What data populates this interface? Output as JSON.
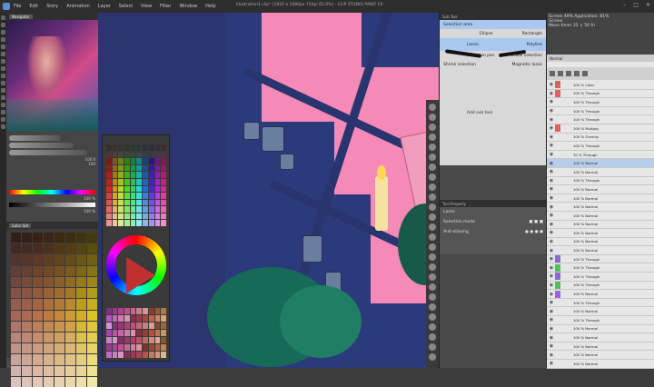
{
  "menubar": {
    "items": [
      "File",
      "Edit",
      "Story",
      "Animation",
      "Layer",
      "Select",
      "View",
      "Filter",
      "Window",
      "Help"
    ],
    "title": "Illustration1.clip* (1920 x 1080px 72dpi 65.0%) - CLIP STUDIO PAINT EX"
  },
  "canvas_tabs": [
    "Illustration1",
    "Sketch2",
    "Comm",
    "Painting (2)"
  ],
  "navigator": {
    "tab": "Navigator"
  },
  "brush": {
    "size_label": "100.0",
    "opacity_label": "100"
  },
  "color": {
    "values": [
      "100 %",
      "100 %",
      "100 %"
    ]
  },
  "colorset": {
    "tab": "Color Set"
  },
  "toolprop": {
    "tab": "Sub Tool",
    "items": [
      {
        "label": "Selection area",
        "active": true
      },
      {
        "label": "Ellipse",
        "right": "Rectangle"
      },
      {
        "label": "Lasso",
        "right": "Polyline",
        "active": true
      },
      {
        "label": "Selection pen",
        "right": "Erase selection"
      },
      {
        "label": "Shrink selection",
        "right": "Magnetic lasso"
      }
    ],
    "add_subtool": "Add sub tool",
    "lower_tab": "Tool Property",
    "lower_title": "Lasso",
    "option1": "Selection mode",
    "option2": "Anti-aliasing"
  },
  "layers": {
    "header_lines": [
      "Screen 49% Application: 81%",
      "Screen",
      "Move timer   22 × 50 fn"
    ],
    "blend_mode": "Normal",
    "rows": [
      {
        "name": "100 % Color",
        "mark": "#e06060"
      },
      {
        "name": "100 % Through",
        "mark": "#e06060"
      },
      {
        "name": "100 % Through",
        "mark": ""
      },
      {
        "name": "100 % Through",
        "mark": ""
      },
      {
        "name": "100 % Through",
        "mark": ""
      },
      {
        "name": "100 % Multiply",
        "mark": "#e06060"
      },
      {
        "name": "100 % Overlay",
        "mark": ""
      },
      {
        "name": "100 % Through",
        "mark": ""
      },
      {
        "name": "70 % Through",
        "mark": ""
      },
      {
        "name": "100 % Normal",
        "mark": "",
        "sel": true
      },
      {
        "name": "100 % Normal",
        "mark": ""
      },
      {
        "name": "100 % Through",
        "mark": ""
      },
      {
        "name": "100 % Normal",
        "mark": ""
      },
      {
        "name": "100 % Normal",
        "mark": ""
      },
      {
        "name": "100 % Normal",
        "mark": ""
      },
      {
        "name": "100 % Normal",
        "mark": ""
      },
      {
        "name": "100 % Normal",
        "mark": ""
      },
      {
        "name": "100 % Normal",
        "mark": ""
      },
      {
        "name": "100 % Normal",
        "mark": ""
      },
      {
        "name": "100 % Normal",
        "mark": ""
      },
      {
        "name": "100 % Through",
        "mark": "#8a6ad0"
      },
      {
        "name": "100 % Through",
        "mark": "#50c060"
      },
      {
        "name": "100 % Through",
        "mark": "#8a6ad0"
      },
      {
        "name": "100 % Through",
        "mark": "#50c060"
      },
      {
        "name": "100 % Normal",
        "mark": "#a060e0"
      },
      {
        "name": "100 % Through",
        "mark": ""
      },
      {
        "name": "100 % Normal",
        "mark": ""
      },
      {
        "name": "100 % Through",
        "mark": ""
      },
      {
        "name": "100 % Normal",
        "mark": ""
      },
      {
        "name": "100 % Normal",
        "mark": ""
      },
      {
        "name": "100 % Normal",
        "mark": ""
      },
      {
        "name": "100 % Normal",
        "mark": ""
      },
      {
        "name": "100 % Normal",
        "mark": ""
      }
    ]
  }
}
